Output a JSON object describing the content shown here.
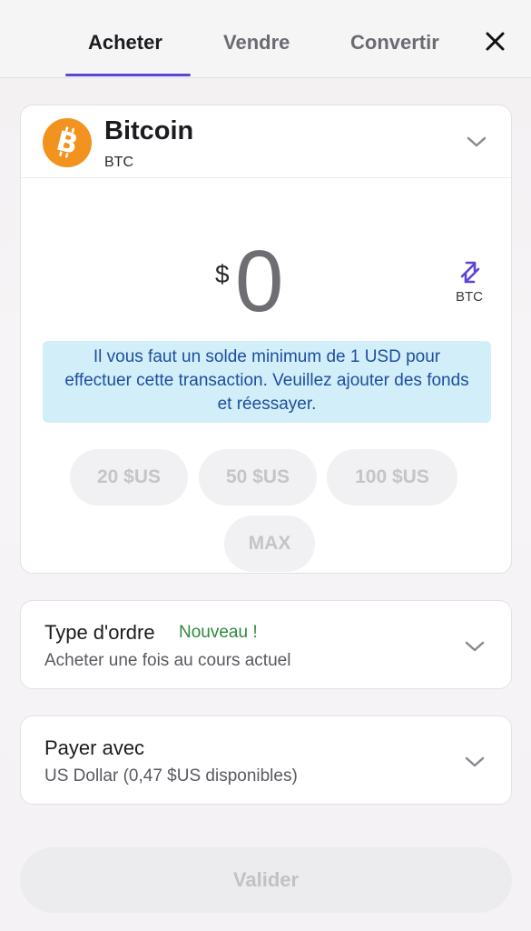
{
  "tabs": [
    {
      "label": "Acheter",
      "active": true
    },
    {
      "label": "Vendre",
      "active": false
    },
    {
      "label": "Convertir",
      "active": false
    }
  ],
  "asset": {
    "name": "Bitcoin",
    "ticker": "BTC",
    "icon": "bitcoin-icon",
    "color": "#F3931F"
  },
  "amount": {
    "currency_symbol": "$",
    "value": "0",
    "switch_label": "BTC"
  },
  "notice": "Il vous faut un solde minimum de 1 USD pour effectuer cette transaction. Veuillez ajouter des fonds et réessayer.",
  "quick_amounts": [
    "20 $US",
    "50 $US",
    "100 $US",
    "MAX"
  ],
  "order_type": {
    "title": "Type d'ordre",
    "badge": "Nouveau !",
    "value": "Acheter une fois au cours actuel"
  },
  "payment": {
    "title": "Payer avec",
    "value": "US Dollar (0,47 $US disponibles)"
  },
  "validate_label": "Valider",
  "colors": {
    "accent": "#5A45D6",
    "info_bg": "#D2EEF8",
    "info_text": "#1E4FA0",
    "badge_green": "#2D8A3C"
  }
}
